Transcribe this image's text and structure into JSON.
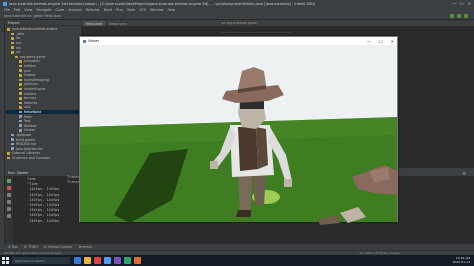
{
  "ide": {
    "title": "java-tutorials-helmet-engine-3d-tutorials-hudson - [C:\\Users\\user\\IdeaProjects\\java-tutorials-helmet-engine-3d] - ...\\src\\Assignment\\Hello.java [java-tutorials] - IntelliJ IDEA",
    "menu": [
      "File",
      "Edit",
      "View",
      "Navigate",
      "Code",
      "Analyze",
      "Refactor",
      "Build",
      "Run",
      "Tools",
      "VCS",
      "Window",
      "Help"
    ],
    "toolbar_path": "java-tutorials  src  game  Hello.java",
    "project_header": "Project",
    "tree": [
      {
        "label": "java-tutorials-helmet-engine",
        "kind": "folder",
        "indent": 0
      },
      {
        "label": ".idea",
        "kind": "folder",
        "indent": 1
      },
      {
        "label": "lib",
        "kind": "folder",
        "indent": 1
      },
      {
        "label": "out",
        "kind": "folder",
        "indent": 1
      },
      {
        "label": "res",
        "kind": "folder",
        "indent": 1
      },
      {
        "label": "src",
        "kind": "folder",
        "indent": 1
      },
      {
        "label": "org.game.game",
        "kind": "folder",
        "indent": 2
      },
      {
        "label": "animation",
        "kind": "folder",
        "indent": 3
      },
      {
        "label": "entities",
        "kind": "folder",
        "indent": 3
      },
      {
        "label": "guis",
        "kind": "folder",
        "indent": 3
      },
      {
        "label": "models",
        "kind": "folder",
        "indent": 3
      },
      {
        "label": "normalMapping",
        "kind": "folder",
        "indent": 3
      },
      {
        "label": "particles",
        "kind": "folder",
        "indent": 3
      },
      {
        "label": "renderEngine",
        "kind": "folder",
        "indent": 3
      },
      {
        "label": "shaders",
        "kind": "folder",
        "indent": 3
      },
      {
        "label": "terrains",
        "kind": "folder",
        "indent": 3
      },
      {
        "label": "textures",
        "kind": "folder",
        "indent": 3
      },
      {
        "label": "utils",
        "kind": "folder",
        "indent": 3
      },
      {
        "label": "HelloWorld",
        "kind": "file",
        "indent": 3,
        "selected": true
      },
      {
        "label": "Main",
        "kind": "file",
        "indent": 3
      },
      {
        "label": "Test",
        "kind": "file",
        "indent": 3
      },
      {
        "label": "Window",
        "kind": "file",
        "indent": 3
      },
      {
        "label": "Viewer",
        "kind": "file",
        "indent": 3
      },
      {
        "label": ".gitignore",
        "kind": "file",
        "indent": 1
      },
      {
        "label": "build.gradle",
        "kind": "file",
        "indent": 1
      },
      {
        "label": "README.md",
        "kind": "file",
        "indent": 1
      },
      {
        "label": "java-tutorials.iml",
        "kind": "file",
        "indent": 1
      },
      {
        "label": "External Libraries",
        "kind": "folder",
        "indent": 0
      },
      {
        "label": "Scratches and Consoles",
        "kind": "folder",
        "indent": 0
      }
    ],
    "editor_tabs": [
      "Hello.java",
      "Viewer.java"
    ],
    "breadcrumb": "src  org.example.game"
  },
  "run": {
    "header": "Run:  Viewer",
    "output_left": "Time\n\"Time\n 144fps, 144fps\n 144fps, 144fps\n 144fps, 144fps\n 144fps, 144fps\n 144fps, 144fps\n 144fps, 144fps\n 144fps, 144fps",
    "output_right": "Transmi\nTransm"
  },
  "bottom_tabs": [
    "4: Run",
    "6: TODO",
    "9: Version Control",
    "Terminal"
  ],
  "status": {
    "left": "All files are up-to-date (moments ago)",
    "right": "1:1   CRLF   UTF-8   Git: master"
  },
  "taskbar": {
    "search": "Type here to search",
    "time": "10:46 AM",
    "date": "2020-01-14",
    "app_colors": [
      "#3a7bd5",
      "#f0b43a",
      "#e0443a",
      "#4e9eff",
      "#7a4fbf",
      "#2fa36b",
      "#e86a2a"
    ]
  },
  "viewer": {
    "title": "Viewer",
    "controls": [
      "—",
      "☐",
      "✕"
    ],
    "colors": {
      "sky": "#eef1f2",
      "grass": "#3f7d22",
      "hat": "#8a6a5e",
      "shirt": "#e6e6e6",
      "vest": "#4a3a2e",
      "pants": "#7a6a5a",
      "skin": "#bdb3a7",
      "highlight": "#c6f06a"
    }
  }
}
